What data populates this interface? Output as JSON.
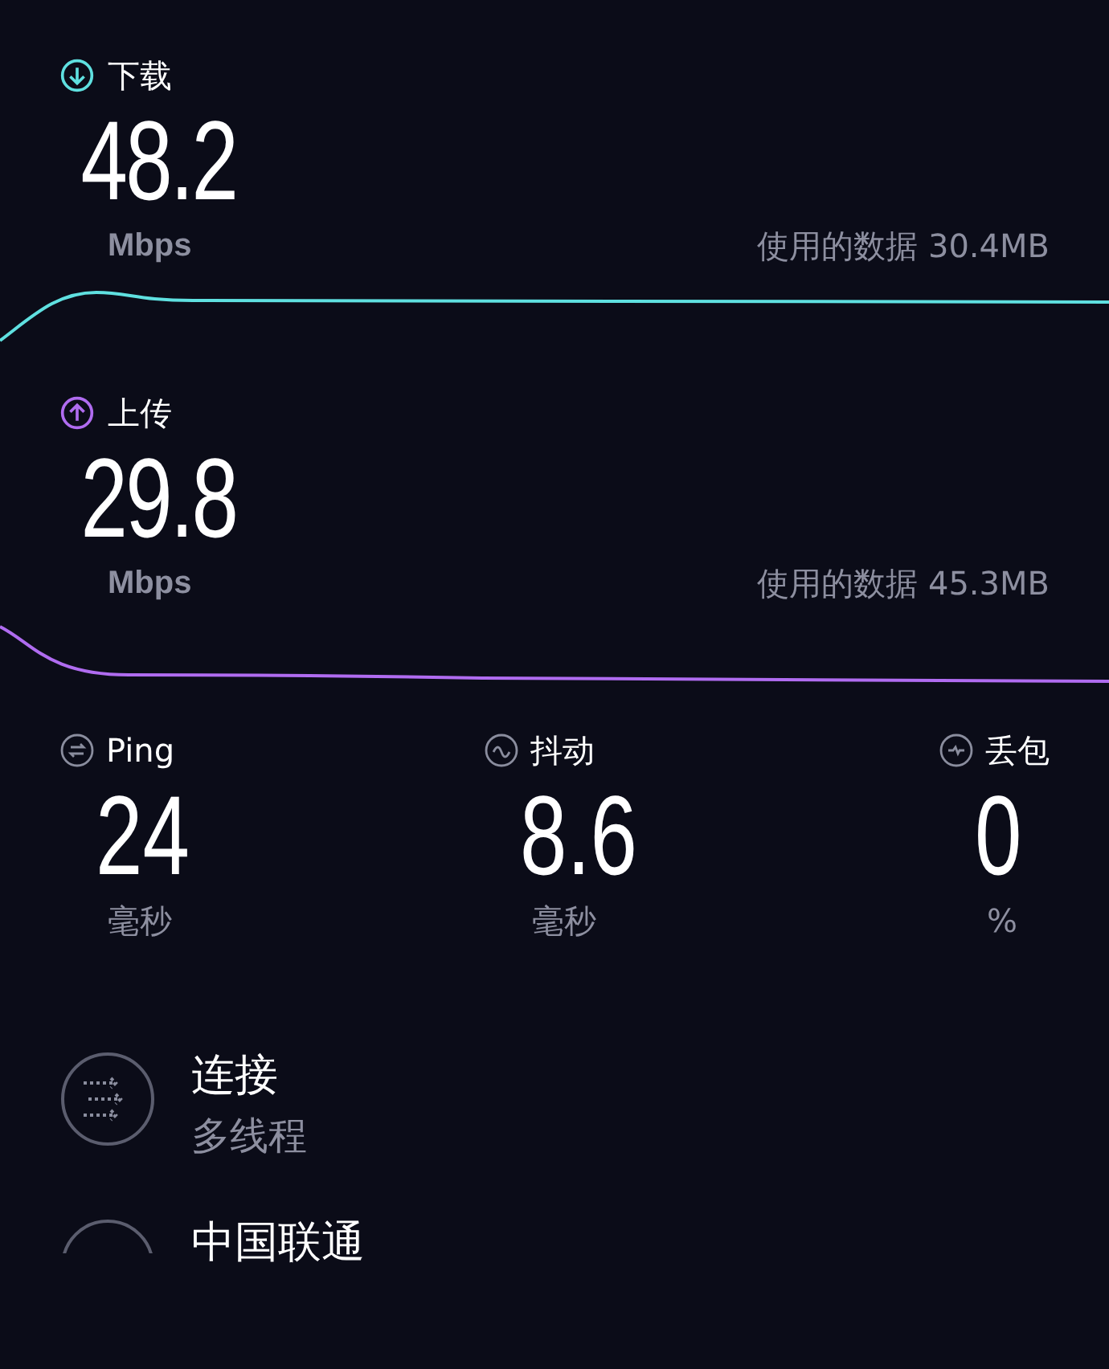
{
  "speeds": [
    {
      "kind": "download",
      "label": "下载",
      "value": "48.2",
      "unit": "Mbps",
      "data_used": "使用的数据 30.4MB"
    },
    {
      "kind": "upload",
      "label": "上传",
      "value": "29.8",
      "unit": "Mbps",
      "data_used": "使用的数据 45.3MB"
    }
  ],
  "metrics": [
    {
      "kind": "ping",
      "label": "Ping",
      "value": "24",
      "unit": "毫秒"
    },
    {
      "kind": "jitter",
      "label": "抖动",
      "value": "8.6",
      "unit": "毫秒"
    },
    {
      "kind": "loss",
      "label": "丢包",
      "value": "0",
      "unit": "%"
    }
  ],
  "details": [
    {
      "kind": "connection",
      "title": "连接",
      "subtitle": "多线程"
    },
    {
      "kind": "provider",
      "title": "中国联通"
    }
  ]
}
